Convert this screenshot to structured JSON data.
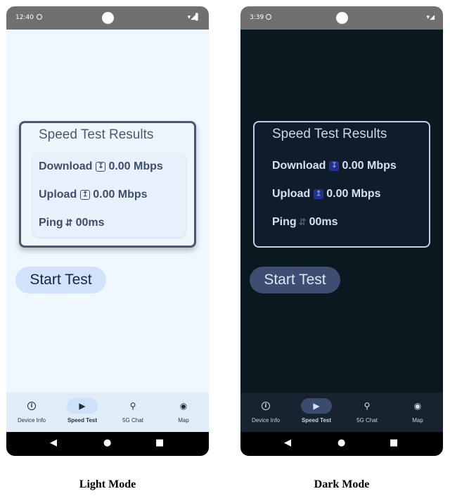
{
  "phones": [
    {
      "theme": "light",
      "status_time": "12:40",
      "status_icons": "▾◢▌",
      "card_title": "Speed Test Results",
      "download_label": "Download",
      "download_value": "0.00 Mbps",
      "upload_label": "Upload",
      "upload_value": "0.00 Mbps",
      "ping_label": "Ping",
      "ping_value": "00ms",
      "start_button": "Start Test",
      "nav": [
        "Device Info",
        "Speed Test",
        "5G Chat",
        "Map"
      ],
      "active_tab": "Speed Test",
      "caption": "Light Mode"
    },
    {
      "theme": "dark",
      "status_time": "3:39",
      "status_icons": "▾◢",
      "card_title": "Speed Test Results",
      "download_label": "Download",
      "download_value": "0.00 Mbps",
      "upload_label": "Upload",
      "upload_value": "0.00 Mbps",
      "ping_label": "Ping",
      "ping_value": "00ms",
      "start_button": "Start Test",
      "nav": [
        "Device Info",
        "Speed Test",
        "5G Chat",
        "Map"
      ],
      "active_tab": "Speed Test",
      "caption": "Dark Mode"
    }
  ],
  "icons": {
    "download": "download-icon",
    "upload": "upload-icon",
    "ping": "swap-arrows-icon",
    "device_info": "info-icon",
    "speed_test": "play-icon",
    "chat": "search-icon",
    "map": "location-pin-icon"
  },
  "colors": {
    "light_bg": "#eef8fe",
    "dark_bg": "#0a1820",
    "status_bar": "#707070",
    "light_button": "#d3e2fb",
    "dark_button": "#3d4e70"
  }
}
